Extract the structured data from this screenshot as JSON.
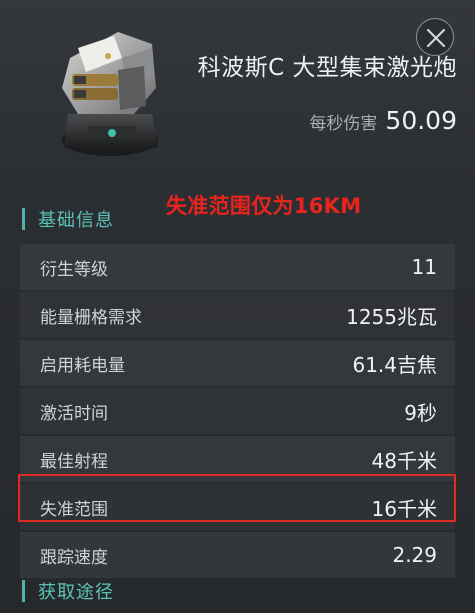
{
  "item": {
    "name": "科波斯C 大型集束激光炮",
    "dps_label": "每秒伤害",
    "dps_value": "50.09",
    "icon": "laser-turret-icon"
  },
  "close_icon": "close-icon",
  "annotation": "失准范围仅为16KM",
  "annotation_color": "#e8241c",
  "accent_color": "#59c3b6",
  "sections": {
    "basic_info": "基础信息",
    "acquire": "获取途径"
  },
  "attributes": [
    {
      "label": "衍生等级",
      "value": "11"
    },
    {
      "label": "能量栅格需求",
      "value": "1255兆瓦"
    },
    {
      "label": "启用耗电量",
      "value": "61.4吉焦"
    },
    {
      "label": "激活时间",
      "value": "9秒"
    },
    {
      "label": "最佳射程",
      "value": "48千米"
    },
    {
      "label": "失准范围",
      "value": "16千米"
    },
    {
      "label": "跟踪速度",
      "value": "2.29"
    }
  ]
}
